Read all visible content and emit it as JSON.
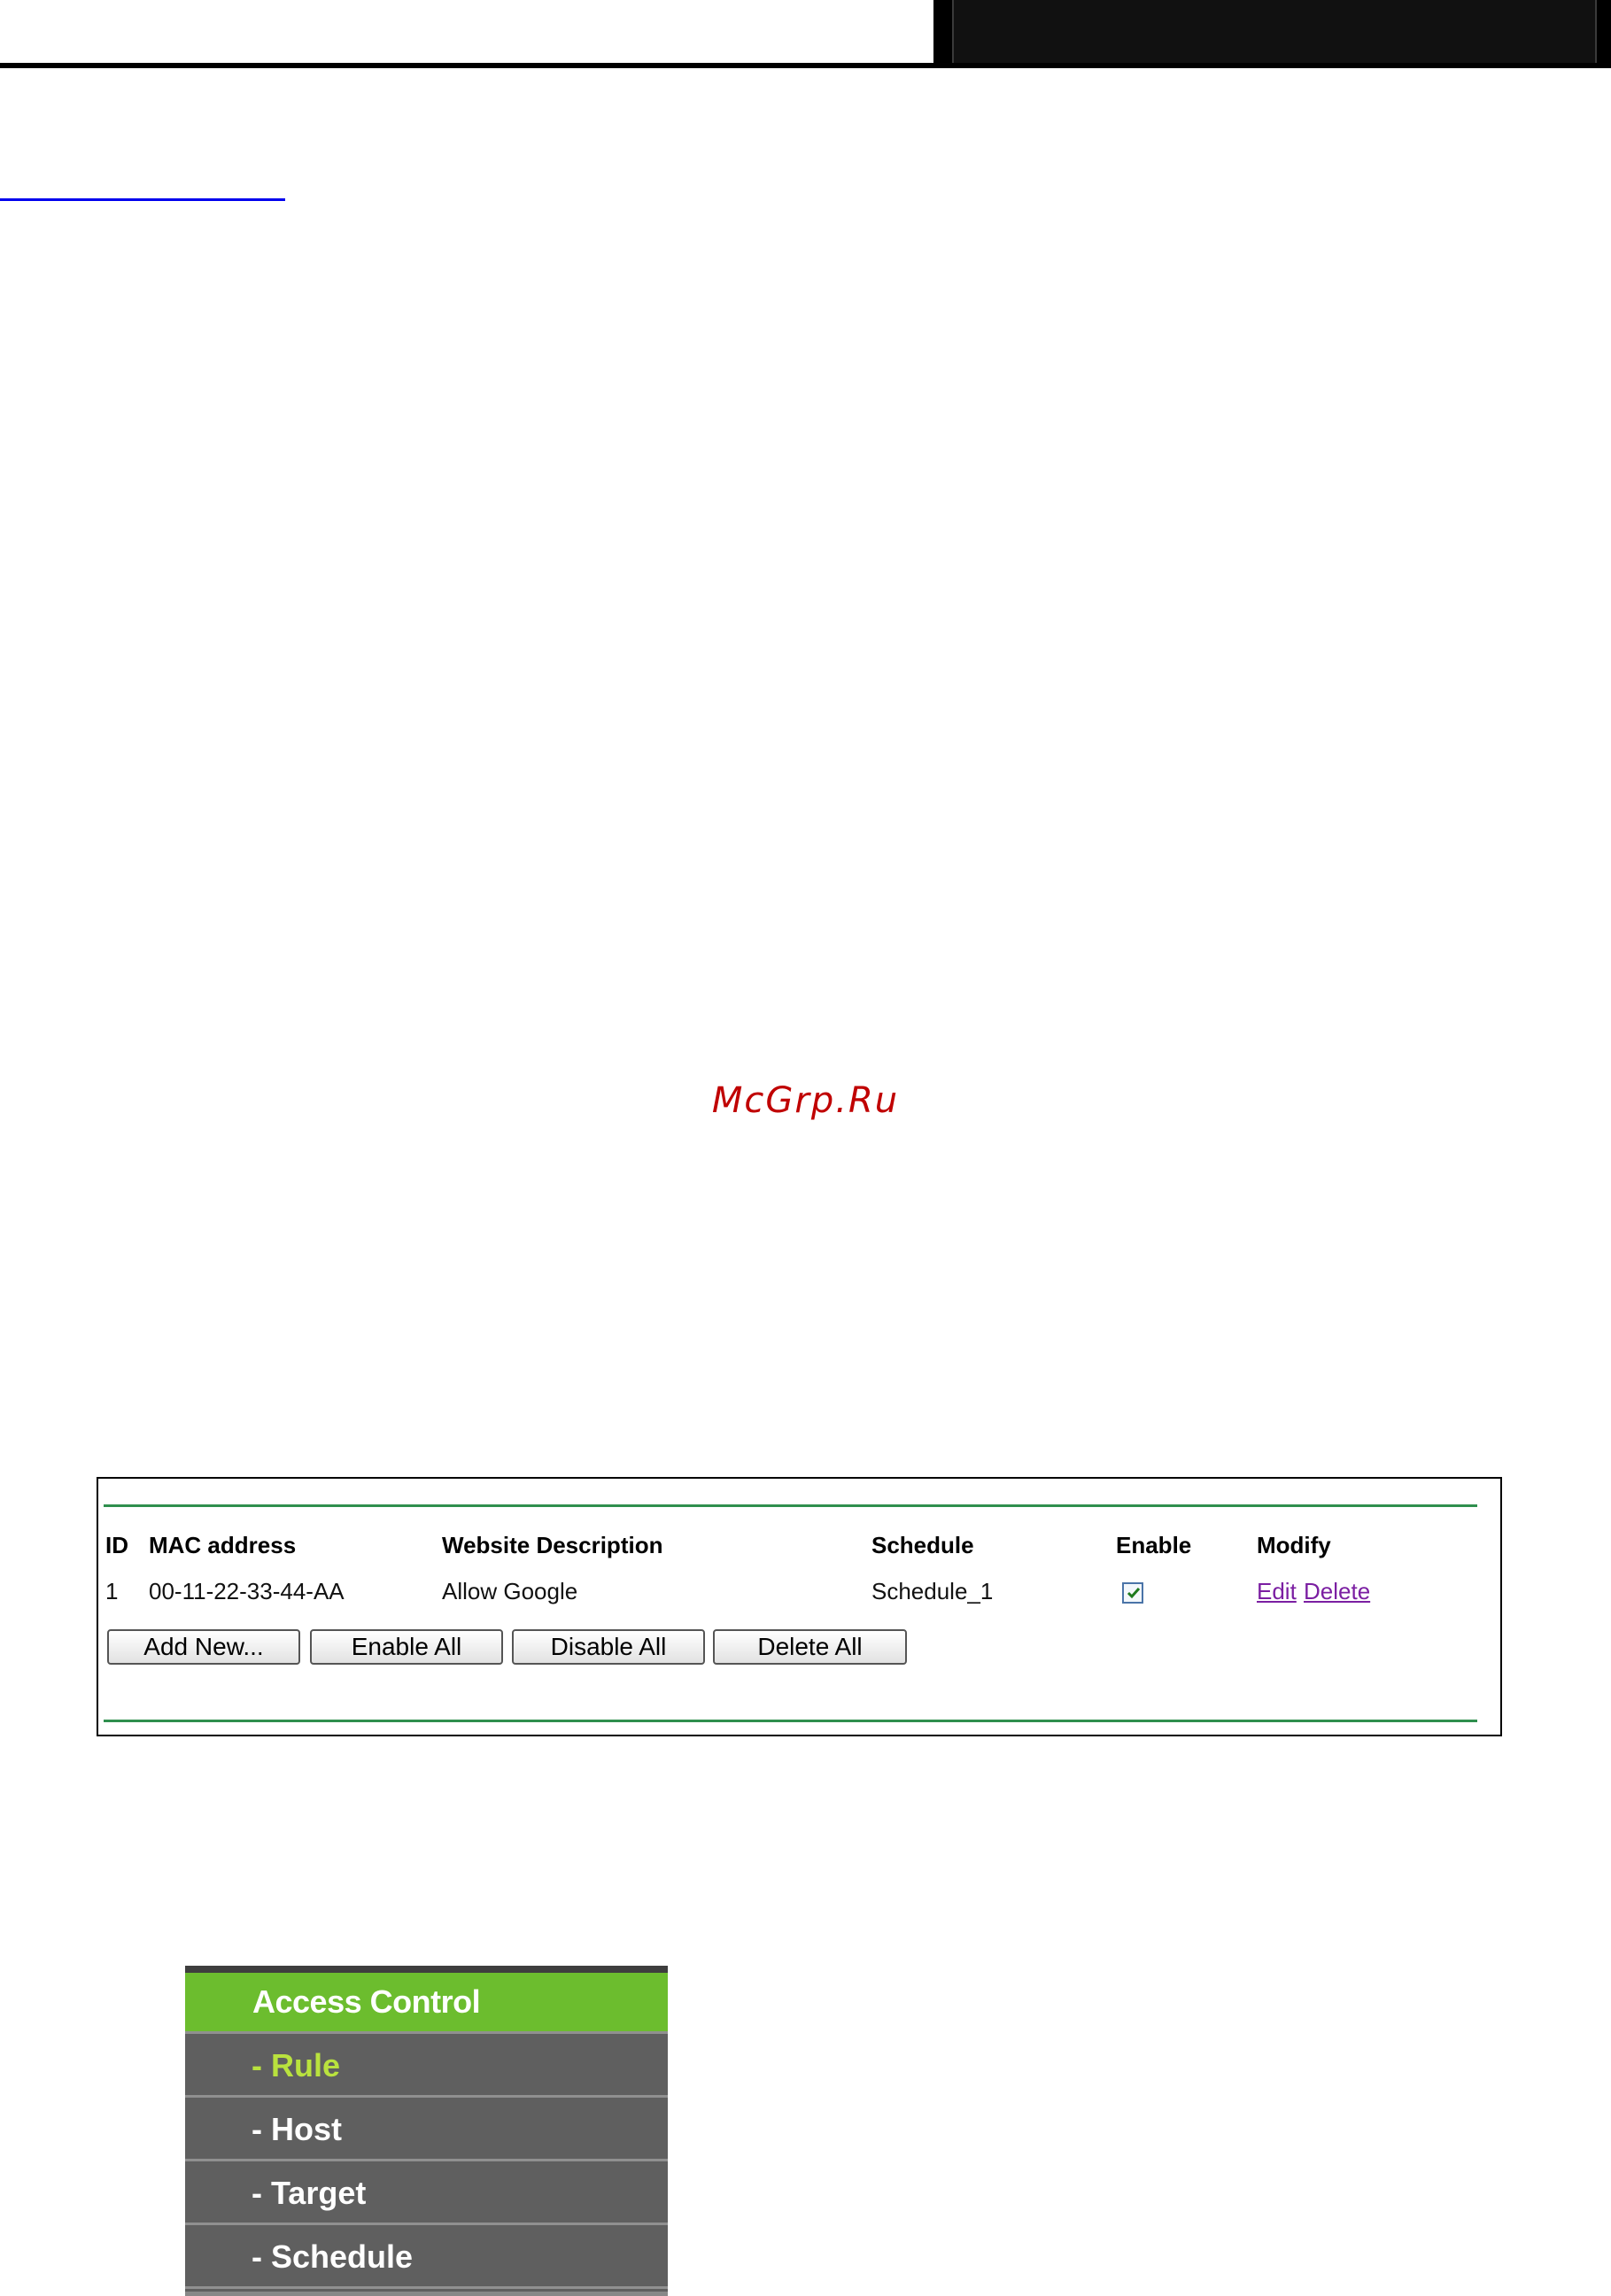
{
  "watermark": "McGrp.Ru",
  "rules_table": {
    "columns": [
      "ID",
      "MAC address",
      "Website Description",
      "Schedule",
      "Enable",
      "Modify"
    ],
    "rows": [
      {
        "id": "1",
        "mac": "00-11-22-33-44-AA",
        "description": "Allow Google",
        "schedule": "Schedule_1",
        "enabled": true,
        "edit_label": "Edit",
        "delete_label": "Delete"
      }
    ],
    "buttons": {
      "add_new": "Add New...",
      "enable_all": "Enable All",
      "disable_all": "Disable All",
      "delete_all": "Delete All"
    },
    "accent_color": "#2f8f4e"
  },
  "menu": {
    "title": "Access Control",
    "items": [
      "- Rule",
      "- Host",
      "- Target",
      "- Schedule"
    ],
    "active_index": 0,
    "colors": {
      "title_bg": "#6cbd2e",
      "item_bg": "#5f5f5f",
      "active_text": "#b9e23e"
    }
  }
}
